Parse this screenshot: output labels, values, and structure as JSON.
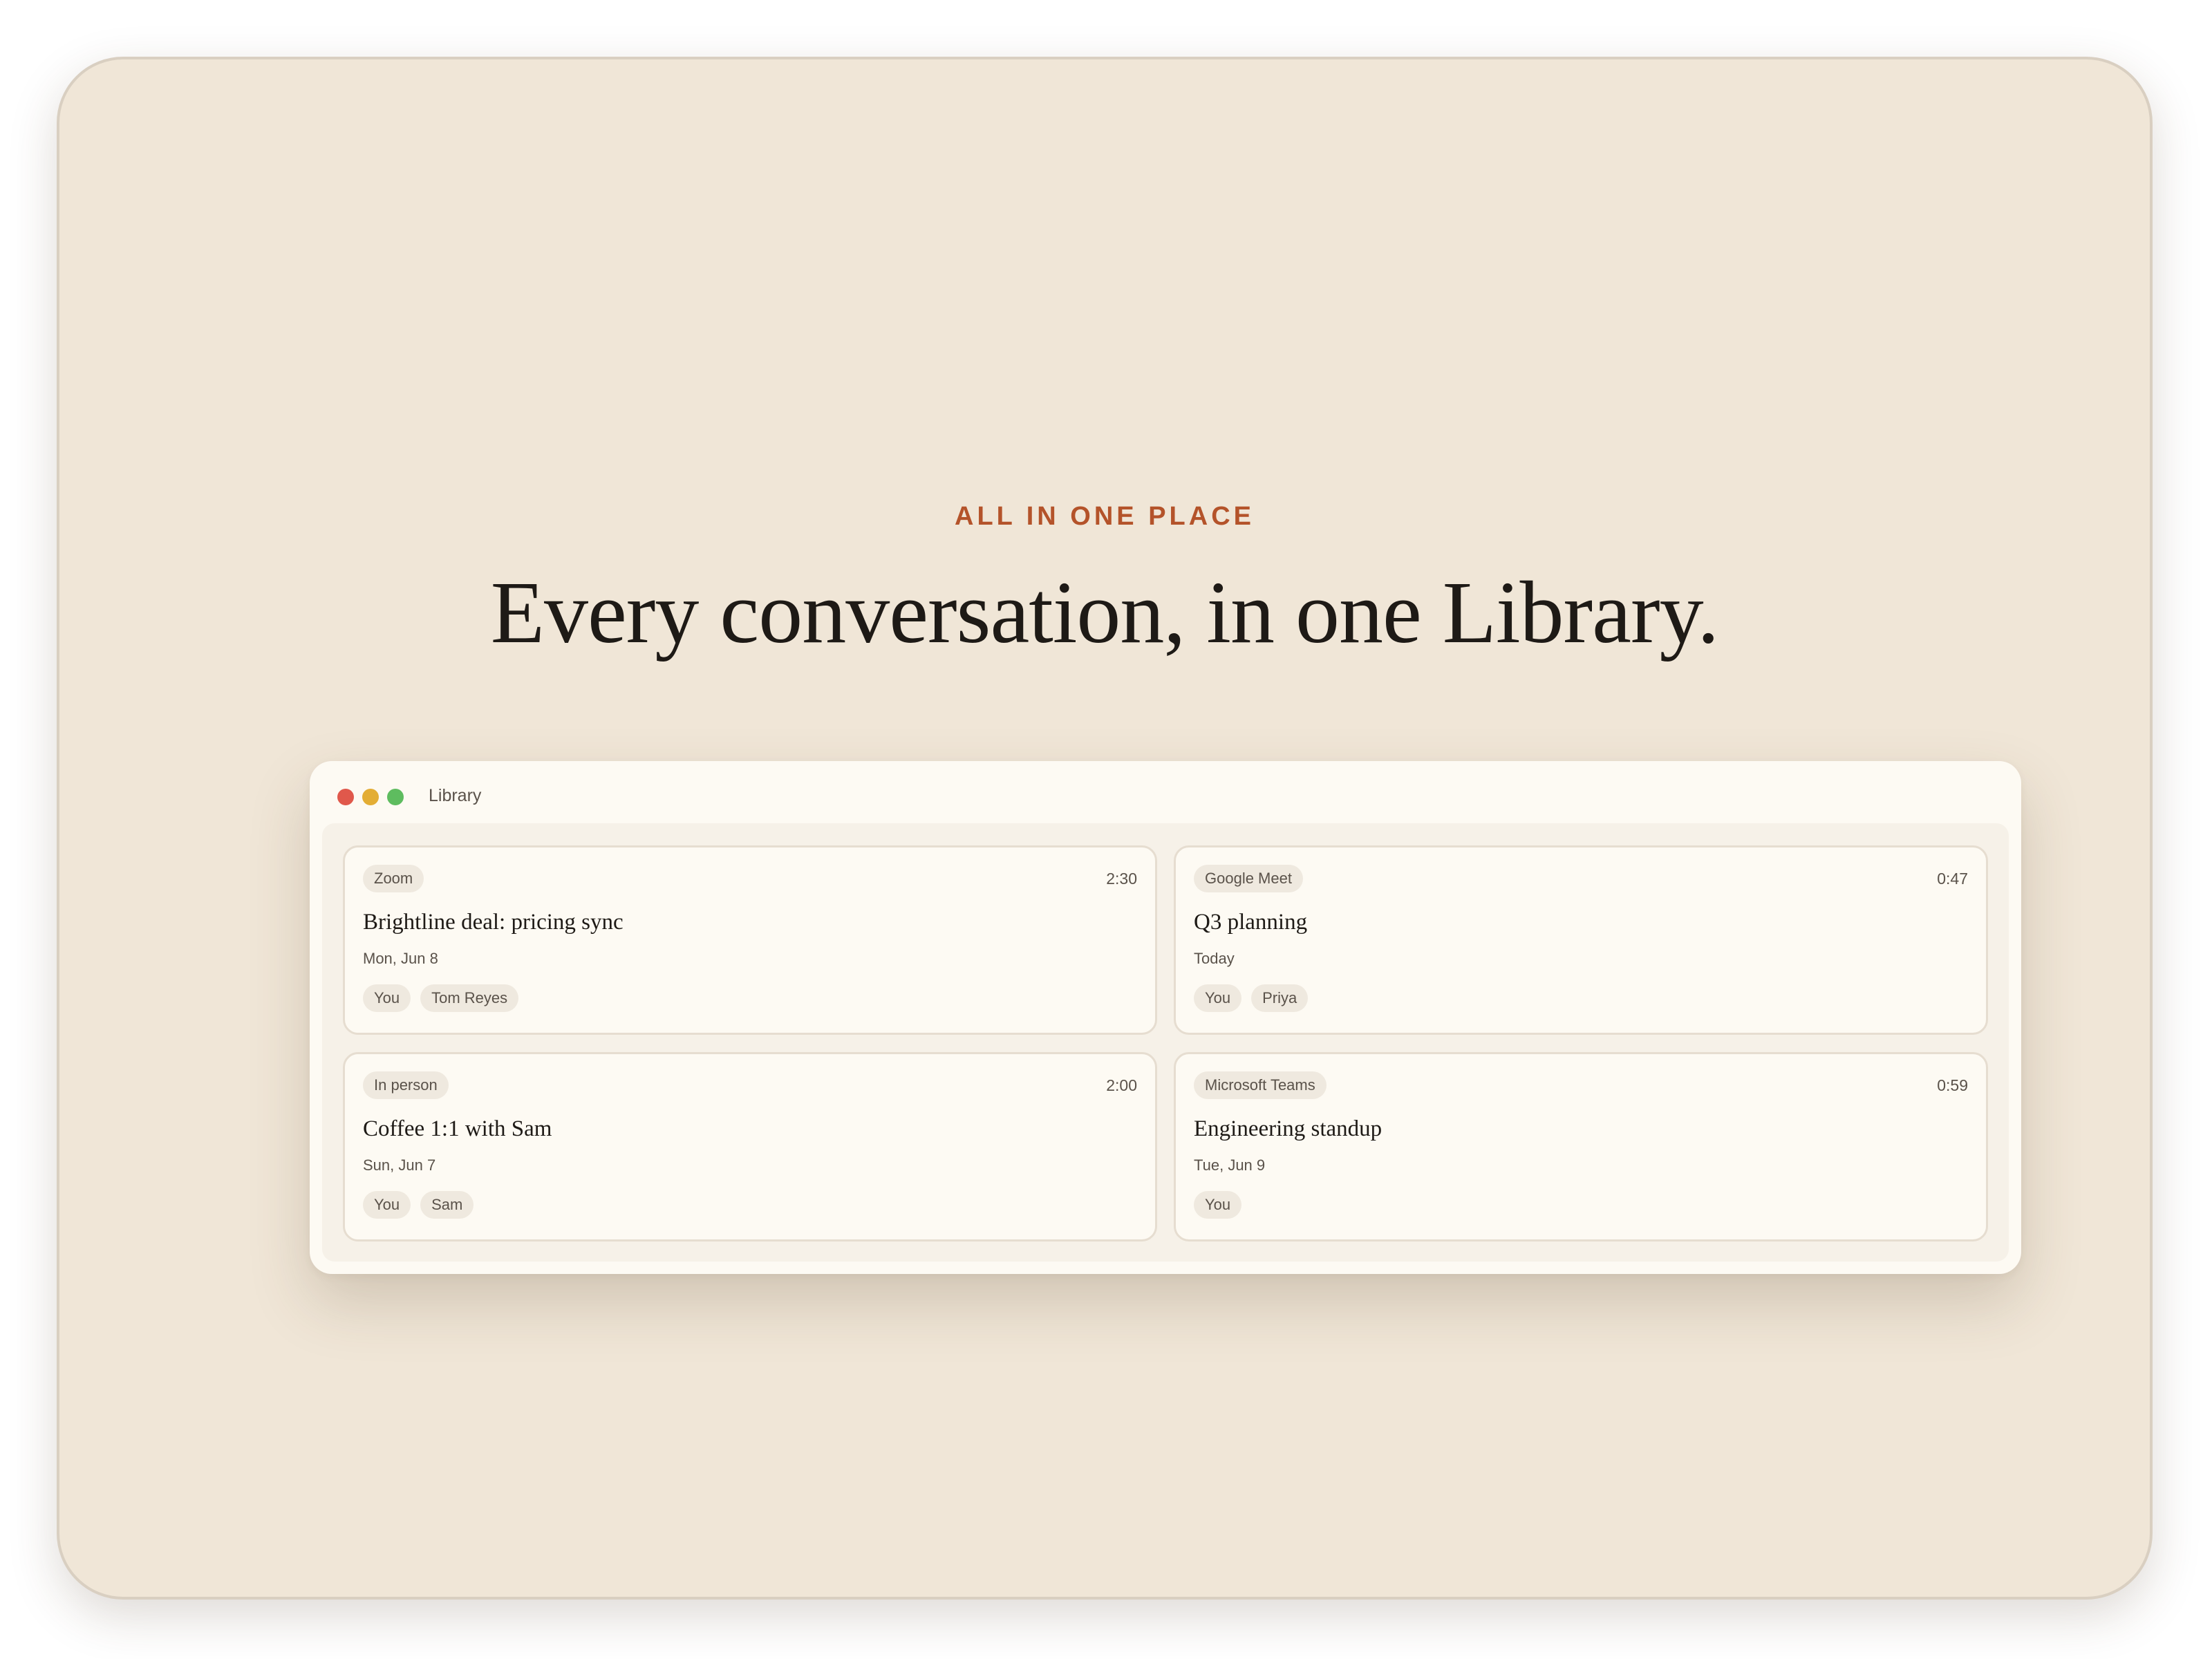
{
  "hero": {
    "eyebrow": "ALL IN ONE PLACE",
    "headline": "Every conversation, in one Library."
  },
  "window": {
    "title": "Library",
    "controls": [
      "close",
      "minimize",
      "maximize"
    ]
  },
  "cards": [
    {
      "source": "Zoom",
      "duration": "2:30",
      "title": "Brightline deal: pricing sync",
      "date": "Mon, Jun 8",
      "participants": [
        "You",
        "Tom Reyes"
      ]
    },
    {
      "source": "Google Meet",
      "duration": "0:47",
      "title": "Q3 planning",
      "date": "Today",
      "participants": [
        "You",
        "Priya"
      ]
    },
    {
      "source": "In person",
      "duration": "2:00",
      "title": "Coffee 1:1 with Sam",
      "date": "Sun, Jun 7",
      "participants": [
        "You",
        "Sam"
      ]
    },
    {
      "source": "Microsoft Teams",
      "duration": "0:59",
      "title": "Engineering standup",
      "date": "Tue, Jun 9",
      "participants": [
        "You"
      ]
    }
  ],
  "colors": {
    "background": "#f0e6d7",
    "accent": "#b4532a",
    "window": "#fdfaf3",
    "close": "#e0584b",
    "minimize": "#e3ad34",
    "maximize": "#5ebc5f"
  }
}
